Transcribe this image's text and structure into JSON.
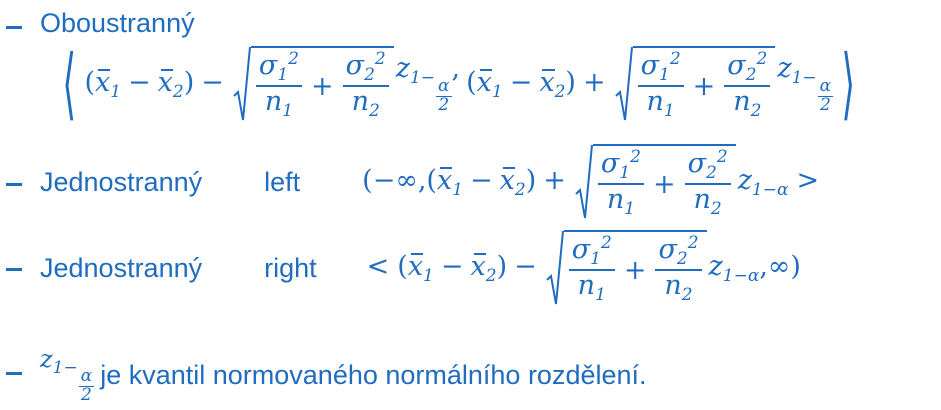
{
  "items": [
    {
      "label": "Oboustranný"
    },
    {
      "label": "Jednostranný",
      "side": "left"
    },
    {
      "label": "Jednostranný",
      "side": "right"
    }
  ],
  "note": {
    "text": "je kvantil normovaného normálního rozdělení."
  },
  "math": {
    "open_paren": "(",
    "close_paren": ")",
    "minus": "−",
    "plus": "+",
    "comma": ",",
    "x": "x",
    "one": "1",
    "two": "2",
    "sigma": "σ",
    "sq": "2",
    "n": "n",
    "z": "z",
    "one_minus": "1−",
    "alpha": "α",
    "infinity": "∞",
    "lt": "<",
    "gt": ">",
    "lang": "⟨",
    "rang": "⟩"
  },
  "colors": {
    "text": "#1f6cc0"
  }
}
